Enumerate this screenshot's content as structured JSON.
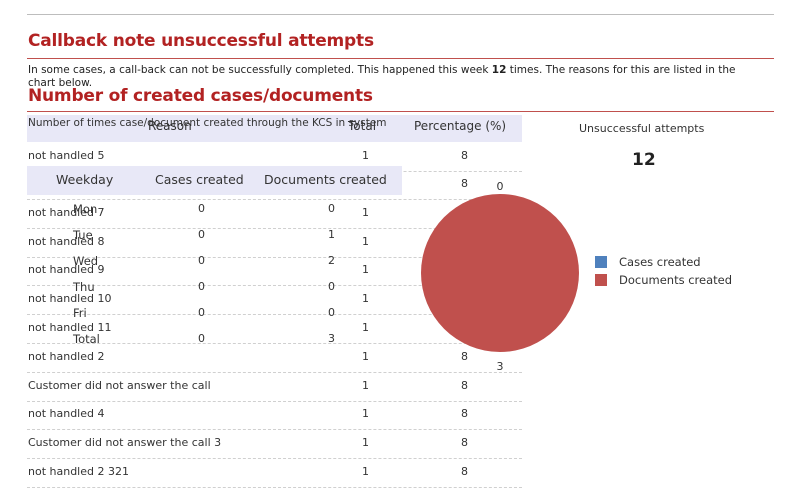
{
  "callback": {
    "title": "Callback note unsuccessful attempts",
    "intro_before": "In some cases, a call-back can not be successfully completed. This happened this week ",
    "intro_count": "12",
    "intro_after": " times. The reasons for this are listed in the chart below.",
    "columns": {
      "reason": "Reason",
      "total": "Total",
      "percentage": "Percentage (%)"
    },
    "rows": [
      {
        "reason": "not handled 5",
        "total": "1",
        "percentage": "8"
      },
      {
        "reason": "",
        "total": "",
        "percentage": "8"
      },
      {
        "reason": "not handled 7",
        "total": "1",
        "percentage": ""
      },
      {
        "reason": "not handled 8",
        "total": "1",
        "percentage": ""
      },
      {
        "reason": "not handled 9",
        "total": "1",
        "percentage": ""
      },
      {
        "reason": "not handled 10",
        "total": "1",
        "percentage": ""
      },
      {
        "reason": "not handled 11",
        "total": "1",
        "percentage": ""
      },
      {
        "reason": "not handled 2",
        "total": "1",
        "percentage": "8"
      },
      {
        "reason": "Customer did not answer the call",
        "total": "1",
        "percentage": "8"
      },
      {
        "reason": "not handled 4",
        "total": "1",
        "percentage": "8"
      },
      {
        "reason": "Customer did not answer the call 3",
        "total": "1",
        "percentage": "8"
      },
      {
        "reason": "not handled 2 321",
        "total": "1",
        "percentage": "8"
      }
    ],
    "side_title": "Unsuccessful attempts",
    "side_count": "12"
  },
  "documents": {
    "title": "Number of created cases/documents",
    "subtitle": "Number of times case/document created through the KCS in system",
    "columns": {
      "weekday": "Weekday",
      "cases": "Cases created",
      "documents": "Documents created"
    },
    "rows": [
      {
        "day": "Mon",
        "cases": "0",
        "documents": "0"
      },
      {
        "day": "Tue",
        "cases": "0",
        "documents": "1"
      },
      {
        "day": "Wed",
        "cases": "0",
        "documents": "2"
      },
      {
        "day": "Thu",
        "cases": "0",
        "documents": "0"
      },
      {
        "day": "Fri",
        "cases": "0",
        "documents": "0"
      },
      {
        "day": "Total",
        "cases": "0",
        "documents": "3"
      }
    ]
  },
  "chart_data": {
    "type": "pie",
    "labels": [
      "Cases created",
      "Documents created"
    ],
    "values": [
      0,
      3
    ],
    "colors": [
      "#4f81bd",
      "#c0504d"
    ],
    "data_labels": [
      "0",
      "3"
    ],
    "legend": "right"
  }
}
